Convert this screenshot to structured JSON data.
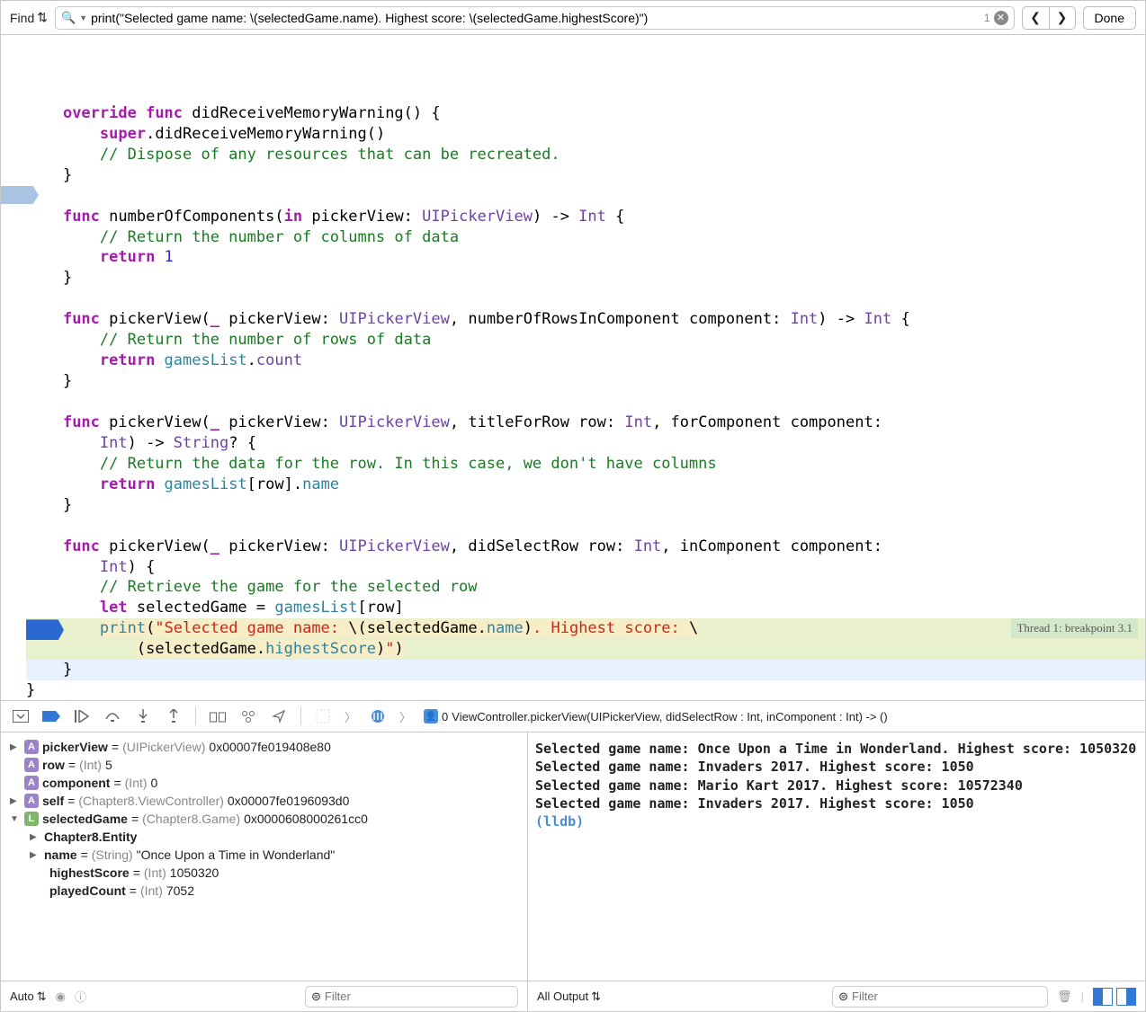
{
  "findbar": {
    "mode": "Find",
    "query": "print(\"Selected game name: \\(selectedGame.name). Highest score: \\(selectedGame.highestScore)\")",
    "results": "1",
    "done": "Done"
  },
  "code": {
    "line1a": "override",
    "line1b": " func",
    "line1c": " didReceiveMemoryWarning() {",
    "line2a": "super",
    "line2b": ".didReceiveMemoryWarning()",
    "line3": "// Dispose of any resources that can be recreated.",
    "line4": "}",
    "line5a": "func",
    "line5b": " numberOfComponents(",
    "line5c": "in",
    "line5d": " pickerView: ",
    "line5e": "UIPickerView",
    "line5f": ") -> ",
    "line5g": "Int",
    "line5h": " {",
    "line6": "// Return the number of columns of data",
    "line7a": "return",
    "line7b": " 1",
    "line8": "}",
    "line9a": "func",
    "line9b": " pickerView(",
    "line9c": "_",
    "line9d": " pickerView: ",
    "line9e": "UIPickerView",
    "line9f": ", numberOfRowsInComponent component: ",
    "line9g": "Int",
    "line9h": ") -> ",
    "line9i": "Int",
    "line9j": " {",
    "line10": "// Return the number of rows of data",
    "line11a": "return",
    "line11b": " gamesList",
    "line11c": ".",
    "line11d": "count",
    "line12": "}",
    "line13a": "func",
    "line13b": " pickerView(",
    "line13c": "_",
    "line13d": " pickerView: ",
    "line13e": "UIPickerView",
    "line13f": ", titleForRow row: ",
    "line13g": "Int",
    "line13h": ", forComponent component:",
    "line13_2a": "Int",
    "line13_2b": ") -> ",
    "line13_2c": "String",
    "line13_2d": "? {",
    "line14": "// Return the data for the row. In this case, we don't have columns",
    "line15a": "return",
    "line15b": " gamesList",
    "line15c": "[row].",
    "line15d": "name",
    "line16": "}",
    "line17a": "func",
    "line17b": " pickerView(",
    "line17c": "_",
    "line17d": " pickerView: ",
    "line17e": "UIPickerView",
    "line17f": ", didSelectRow row: ",
    "line17g": "Int",
    "line17h": ", inComponent component:",
    "line17_2a": "Int",
    "line17_2b": ") {",
    "line18": "// Retrieve the game for the selected row",
    "line19a": "let",
    "line19b": " selectedGame = ",
    "line19c": "gamesList",
    "line19d": "[row]",
    "line20a": "print",
    "line20b": "(",
    "line20c": "\"Selected game name: ",
    "line20d": "\\(",
    "line20e": "selectedGame.",
    "line20f": "name",
    "line20g": ")",
    "line20h": ". Highest score: ",
    "line20i": "\\",
    "line20_2a": "(",
    "line20_2b": "selectedGame.",
    "line20_2c": "highestScore",
    "line20_2d": ")",
    "line20_2e": "\"",
    "line20_2f": ")",
    "line21": "}",
    "line22": "}"
  },
  "breakpoint_msg": "Thread 1: breakpoint 3.1",
  "crumb": {
    "idx": "0",
    "text": "ViewController.pickerView(UIPickerView, didSelectRow : Int, inComponent : Int) -> ()"
  },
  "vars": [
    {
      "disclosure": "▶",
      "badge": "A",
      "name": "pickerView",
      "type": "(UIPickerView)",
      "val": "0x00007fe019408e80"
    },
    {
      "disclosure": "",
      "badge": "A",
      "name": "row",
      "type": "(Int)",
      "val": "5"
    },
    {
      "disclosure": "",
      "badge": "A",
      "name": "component",
      "type": "(Int)",
      "val": "0"
    },
    {
      "disclosure": "▶",
      "badge": "A",
      "name": "self",
      "type": "(Chapter8.ViewController)",
      "val": "0x00007fe0196093d0"
    },
    {
      "disclosure": "▼",
      "badge": "L",
      "name": "selectedGame",
      "type": "(Chapter8.Game)",
      "val": "0x0000608000261cc0"
    }
  ],
  "vars_children": [
    {
      "disclosure": "▶",
      "name": "Chapter8.Entity",
      "type": "",
      "val": ""
    },
    {
      "disclosure": "▶",
      "name": "name",
      "type": "(String)",
      "val": "\"Once Upon a Time in Wonderland\""
    },
    {
      "disclosure": "",
      "name": "highestScore",
      "type": "(Int)",
      "val": "1050320"
    },
    {
      "disclosure": "",
      "name": "playedCount",
      "type": "(Int)",
      "val": "7052"
    }
  ],
  "vars_footer": {
    "mode": "Auto",
    "filter": "Filter"
  },
  "console": {
    "lines": [
      "Selected game name: Once Upon a Time in Wonderland. Highest score: 1050320",
      "Selected game name: Invaders 2017. Highest score: 1050",
      "Selected game name: Mario Kart 2017. Highest score: 10572340",
      "Selected game name: Invaders 2017. Highest score: 1050"
    ],
    "prompt": "(lldb) ",
    "mode": "All Output",
    "filter": "Filter"
  }
}
